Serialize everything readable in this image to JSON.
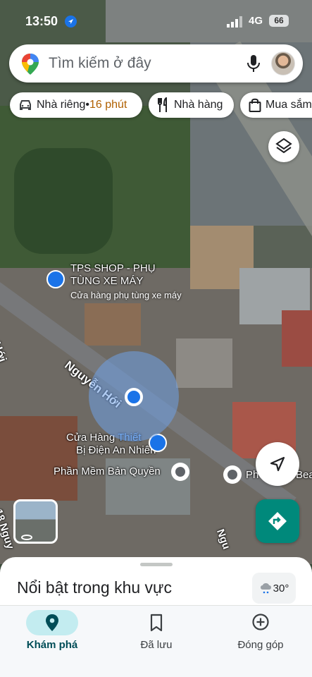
{
  "status_bar": {
    "time": "13:50",
    "network": "4G",
    "battery": "66"
  },
  "search": {
    "placeholder": "Tìm kiếm ở đây"
  },
  "chips": [
    {
      "label": "Nhà riêng",
      "separator": " • ",
      "eta": "16 phút",
      "icon": "car-icon"
    },
    {
      "label": "Nhà hàng",
      "icon": "restaurant-icon"
    },
    {
      "label": "Mua sắm",
      "icon": "shopping-bag-icon"
    }
  ],
  "map": {
    "street_1": "Nguyễn Hới",
    "street_2": "n Hới",
    "street_3": "18 Nguy",
    "street_4": "Ngu",
    "places": [
      {
        "name_line1": "TPS SHOP - PHỤ",
        "name_line2": "TÙNG XE MÁY",
        "category": "Cửa hàng phụ tùng xe máy"
      },
      {
        "name_line1a": "Cửa Hàng ",
        "name_line1b": "Thiết",
        "name_line2": "Bị Điện An Nhiên"
      },
      {
        "name": "Phần Mềm Bản Quyền"
      },
      {
        "name": "Ph",
        "name_tail": "Bea"
      }
    ]
  },
  "sheet": {
    "title": "Nổi bật trong khu vực",
    "weather": "30°"
  },
  "nav": [
    {
      "label": "Khám phá",
      "icon": "explore-pin-icon",
      "active": true
    },
    {
      "label": "Đã lưu",
      "icon": "bookmark-icon",
      "active": false
    },
    {
      "label": "Đóng góp",
      "icon": "add-circle-icon",
      "active": false
    }
  ],
  "colors": {
    "accent": "#1a73e8",
    "nav_active": "#c3ecf0",
    "directions": "#00897b",
    "eta": "#b06000"
  }
}
